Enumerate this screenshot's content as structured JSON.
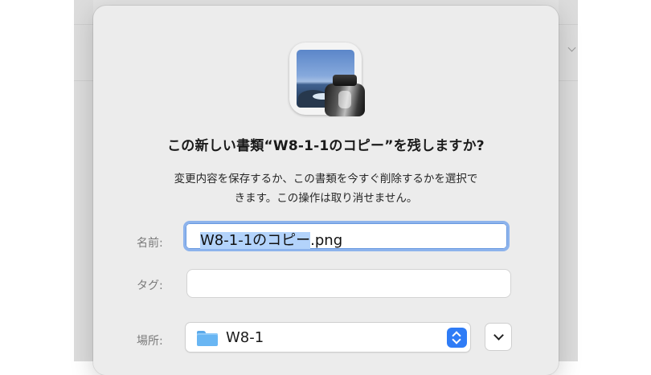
{
  "dialog": {
    "title": "この新しい書類“W8-1-1のコピー”を残しますか?",
    "message_line1": "変更内容を保存するか、この書類を今すぐ削除するかを選択で",
    "message_line2": "きます。この操作は取り消せません。",
    "app_icon": "preview-app-icon"
  },
  "form": {
    "name_label": "名前:",
    "name_value_selected": "W8-1-1のコピー",
    "name_value_extension": ".png",
    "tags_label": "タグ:",
    "tags_value": "",
    "where_label": "場所:",
    "where_value": "W8-1",
    "where_icon": "folder-icon"
  },
  "colors": {
    "accent": "#2f7cf6",
    "selection": "#b3d3fb",
    "focus_ring": "#8db3ec",
    "folder": "#69b6f3"
  }
}
